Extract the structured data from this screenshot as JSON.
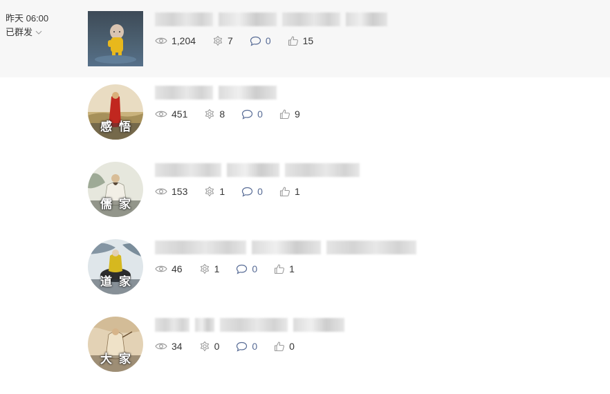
{
  "meta": {
    "time": "昨天 06:00",
    "status": "已群发"
  },
  "articles": [
    {
      "thumb": {
        "icon": "monk-figurine-photo",
        "caption": ""
      },
      "title": "",
      "stats": {
        "reads": "1,204",
        "shares": "7",
        "comments": "0",
        "likes": "15"
      }
    },
    {
      "thumb": {
        "icon": "red-robed-figure-painting",
        "caption": "感悟"
      },
      "title": "",
      "stats": {
        "reads": "451",
        "shares": "8",
        "comments": "0",
        "likes": "9"
      }
    },
    {
      "thumb": {
        "icon": "seated-scholar-painting",
        "caption": "儒家"
      },
      "title": "",
      "stats": {
        "reads": "153",
        "shares": "1",
        "comments": "0",
        "likes": "1"
      }
    },
    {
      "thumb": {
        "icon": "laozi-on-ox-painting",
        "caption": "道家"
      },
      "title": "",
      "stats": {
        "reads": "46",
        "shares": "1",
        "comments": "0",
        "likes": "1"
      }
    },
    {
      "thumb": {
        "icon": "scholar-painting",
        "caption": "大家"
      },
      "title": "",
      "stats": {
        "reads": "34",
        "shares": "0",
        "comments": "0",
        "likes": "0"
      }
    }
  ],
  "colors": {
    "group_background": "#f7f7f7",
    "link_blue": "#576b95",
    "text": "#353535",
    "icon_gray": "#9a9a9a"
  }
}
